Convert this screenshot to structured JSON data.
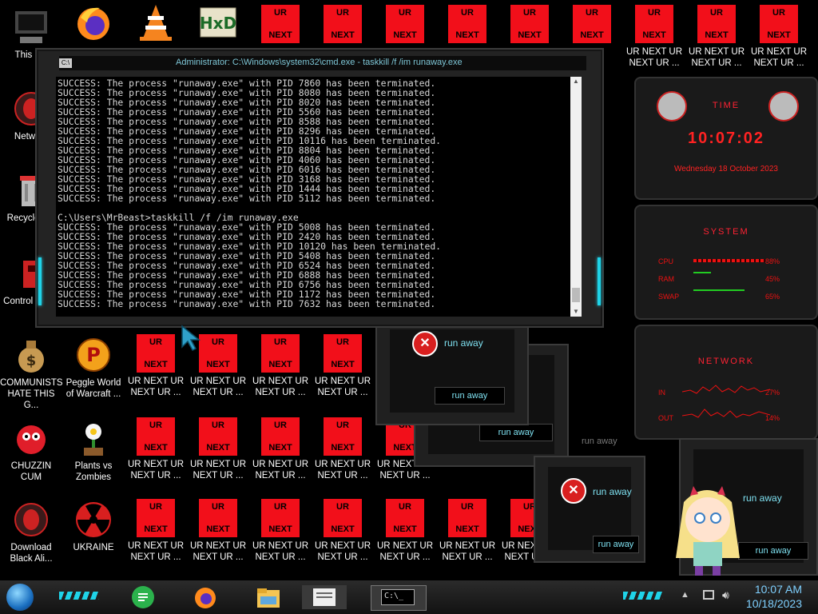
{
  "desktop_icons": [
    {
      "label": "This PC"
    },
    {
      "label": ""
    },
    {
      "label": ""
    },
    {
      "label": ""
    },
    {
      "label": "Network"
    },
    {
      "label": "Recycle Bin"
    },
    {
      "label": "Control Panel"
    },
    {
      "label": "COMMUNISTS HATE THIS G..."
    },
    {
      "label": "Peggle World of Warcraft ..."
    },
    {
      "label": "CHUZZIN CUM"
    },
    {
      "label": "Plants vs Zombies"
    },
    {
      "label": "Download Black Ali..."
    },
    {
      "label": "UKRAINE"
    }
  ],
  "ur_tile": {
    "top": "UR",
    "bottom": "NEXT",
    "label1": "UR NEXT UR",
    "label2": "NEXT UR ..."
  },
  "cmd": {
    "title": "Administrator: C:\\Windows\\system32\\cmd.exe - taskkill  /f /im runaway.exe",
    "icon": "C:\\",
    "output": "SUCCESS: The process \"runaway.exe\" with PID 7860 has been terminated.\nSUCCESS: The process \"runaway.exe\" with PID 8080 has been terminated.\nSUCCESS: The process \"runaway.exe\" with PID 8020 has been terminated.\nSUCCESS: The process \"runaway.exe\" with PID 5560 has been terminated.\nSUCCESS: The process \"runaway.exe\" with PID 8588 has been terminated.\nSUCCESS: The process \"runaway.exe\" with PID 8296 has been terminated.\nSUCCESS: The process \"runaway.exe\" with PID 10116 has been terminated.\nSUCCESS: The process \"runaway.exe\" with PID 8804 has been terminated.\nSUCCESS: The process \"runaway.exe\" with PID 4060 has been terminated.\nSUCCESS: The process \"runaway.exe\" with PID 6016 has been terminated.\nSUCCESS: The process \"runaway.exe\" with PID 3168 has been terminated.\nSUCCESS: The process \"runaway.exe\" with PID 1444 has been terminated.\nSUCCESS: The process \"runaway.exe\" with PID 5112 has been terminated.\n\nC:\\Users\\MrBeast>taskkill /f /im runaway.exe\nSUCCESS: The process \"runaway.exe\" with PID 5008 has been terminated.\nSUCCESS: The process \"runaway.exe\" with PID 2420 has been terminated.\nSUCCESS: The process \"runaway.exe\" with PID 10120 has been terminated.\nSUCCESS: The process \"runaway.exe\" with PID 5408 has been terminated.\nSUCCESS: The process \"runaway.exe\" with PID 6524 has been terminated.\nSUCCESS: The process \"runaway.exe\" with PID 6888 has been terminated.\nSUCCESS: The process \"runaway.exe\" with PID 6756 has been terminated.\nSUCCESS: The process \"runaway.exe\" with PID 1172 has been terminated.\nSUCCESS: The process \"runaway.exe\" with PID 7632 has been terminated."
  },
  "widgets": {
    "time": {
      "title": "TIME",
      "clock": "10:07:02",
      "date": "Wednesday 18 October 2023"
    },
    "system": {
      "title": "SYSTEM",
      "cpu_label": "CPU",
      "cpu": "88%",
      "ram_label": "RAM",
      "ram": "45%",
      "swap_label": "SWAP",
      "swap": "65%"
    },
    "network": {
      "title": "NETWORK",
      "in_label": "IN",
      "in": "27%",
      "out_label": "OUT",
      "out": "14%"
    }
  },
  "dialog": {
    "message": "run away",
    "button": "run away",
    "ghost_title": "run away"
  },
  "taskbar": {
    "time": "10:07 AM",
    "date": "10/18/2023",
    "active_app": "C:\\_"
  },
  "colors": {
    "accent_cyan": "#1fd3e8",
    "tile_red": "#f20f1a",
    "widget_red": "#ff2222",
    "clock_blue": "#7fd0ff"
  }
}
